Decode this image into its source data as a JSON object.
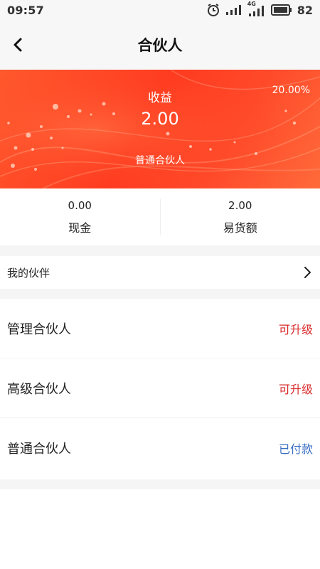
{
  "status_bar": {
    "time": "09:57",
    "network_label": "4G",
    "battery": "82"
  },
  "header": {
    "title": "合伙人"
  },
  "banner": {
    "label": "收益",
    "amount": "2.00",
    "rate": "20.00%",
    "level": "普通合伙人",
    "colors": {
      "start": "#ff5a2e",
      "mid": "#ff3b1f",
      "end": "#ff6a3a"
    }
  },
  "stats": [
    {
      "value": "0.00",
      "label": "现金"
    },
    {
      "value": "2.00",
      "label": "易货额"
    }
  ],
  "partners": {
    "label": "我的伙伴",
    "icon": "chevron-right-icon"
  },
  "levels": [
    {
      "name": "管理合伙人",
      "status": "可升级",
      "status_type": "upgrade"
    },
    {
      "name": "高级合伙人",
      "status": "可升级",
      "status_type": "upgrade"
    },
    {
      "name": "普通合伙人",
      "status": "已付款",
      "status_type": "paid"
    }
  ],
  "colors": {
    "upgrade": "#d92a2a",
    "paid": "#3a6fc4"
  }
}
